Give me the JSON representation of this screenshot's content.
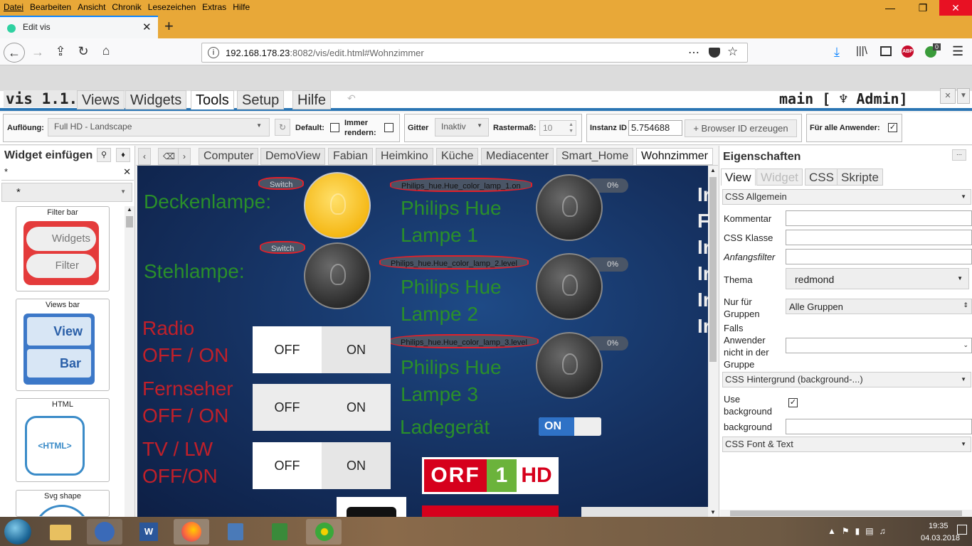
{
  "browser": {
    "menu": [
      "Datei",
      "Bearbeiten",
      "Ansicht",
      "Chronik",
      "Lesezeichen",
      "Extras",
      "Hilfe"
    ],
    "tab_title": "Edit vis",
    "url_host": "192.168.178.23",
    "url_rest": ":8082/vis/edit.html#Wohnzimmer",
    "badge_count": "0",
    "abp_label": "ABP"
  },
  "vis": {
    "brand": "vis 1.1.1",
    "menu": [
      "Views",
      "Widgets",
      "Tools",
      "Setup",
      "Hilfe"
    ],
    "user_label": "main [ ♆ Admin]"
  },
  "toolbar": {
    "resolution_label": "Auflöung:",
    "resolution_value": "Full HD - Landscape",
    "default_label": "Default:",
    "always_render_label": "Immer rendern:",
    "grid_label": "Gitter",
    "grid_value": "Inaktiv",
    "grid_size_label": "Rastermaß:",
    "grid_size_value": "10",
    "instance_label": "Instanz ID",
    "instance_value": "5.754688",
    "browser_id_button": "+ Browser ID erzeugen",
    "all_users_label": "Für alle Anwender:"
  },
  "left": {
    "title": "Widget einfügen",
    "filter_value": "*",
    "select_value": "*",
    "widgets": [
      {
        "title": "Filter bar",
        "btn1": "Widgets",
        "btn2": "Filter"
      },
      {
        "title": "Views bar",
        "btn1": "View",
        "btn2": "Bar"
      },
      {
        "title": "HTML",
        "inner": "<HTML>"
      },
      {
        "title": "Svg shape"
      }
    ]
  },
  "views": [
    "Computer",
    "DemoView",
    "Fabian",
    "Heimkino",
    "Küche",
    "Mediacenter",
    "Smart_Home",
    "Wohnzimmer"
  ],
  "canvas": {
    "deckenlampe": "Deckenlampe:",
    "stehlampe": "Stehlampe:",
    "switch_label": "Switch",
    "hue1": "Philips_hue.Hue_color_lamp_1.on",
    "hue2": "Philips_hue.Hue_color_lamp_2.level",
    "hue3": "Philips_hue.Hue_color_lamp_3.level",
    "pct": "0%",
    "lamp1_a": "Philips Hue",
    "lamp1_b": "Lampe 1",
    "lamp2_a": "Philips Hue",
    "lamp2_b": "Lampe 2",
    "lamp3_a": "Philips Hue",
    "lamp3_b": "Lampe 3",
    "radio_a": "Radio",
    "radio_b": "OFF / ON",
    "tv_a": "Fernseher",
    "tv_b": "OFF / ON",
    "lw_a": "TV / LW",
    "lw_b": "OFF/ON",
    "off": "OFF",
    "on": "ON",
    "charger": "Ladegerät",
    "charger_state": "ON",
    "orf_a": "ORF",
    "orf_b": "1",
    "orf_c": "HD",
    "cut_letters": [
      "Ir",
      "F",
      "Ir",
      "Ir",
      "Ir",
      "Ir"
    ]
  },
  "right": {
    "title": "Eigenschaften",
    "tabs": [
      "View",
      "Widget",
      "CSS",
      "Skripte"
    ],
    "sec_general": "CSS Allgemein",
    "comment": "Kommentar",
    "css_class": "CSS Klasse",
    "initial_filter": "Anfangsfilter",
    "theme": "Thema",
    "theme_value": "redmond",
    "groups_only": "Nur für Gruppen",
    "groups_value": "Alle Gruppen",
    "if_user": "Falls Anwender nicht in der Gruppe",
    "sec_background": "CSS Hintergrund (background-...)",
    "use_bg": "Use background",
    "bg": "background",
    "sec_font": "CSS Font & Text"
  },
  "clock": {
    "time": "19:35",
    "date": "04.03.2018"
  }
}
